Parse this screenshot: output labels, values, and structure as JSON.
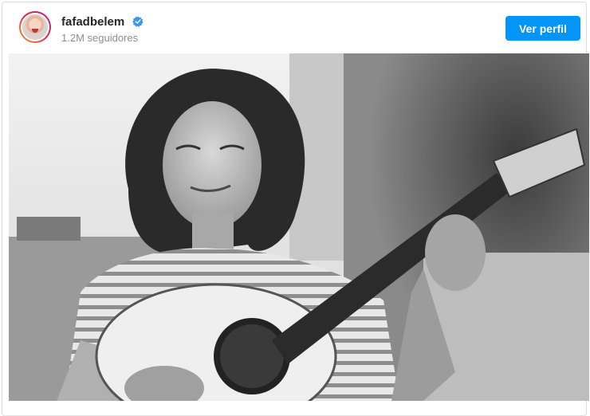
{
  "profile": {
    "username": "fafadbelem",
    "followers": "1.2M seguidores",
    "verified": true
  },
  "actions": {
    "view_profile_label": "Ver perfil"
  },
  "colors": {
    "button_bg": "#0095f6",
    "verified_badge": "#3897f0"
  },
  "icons": {
    "verified": "verified-badge-icon",
    "avatar": "profile-avatar"
  }
}
